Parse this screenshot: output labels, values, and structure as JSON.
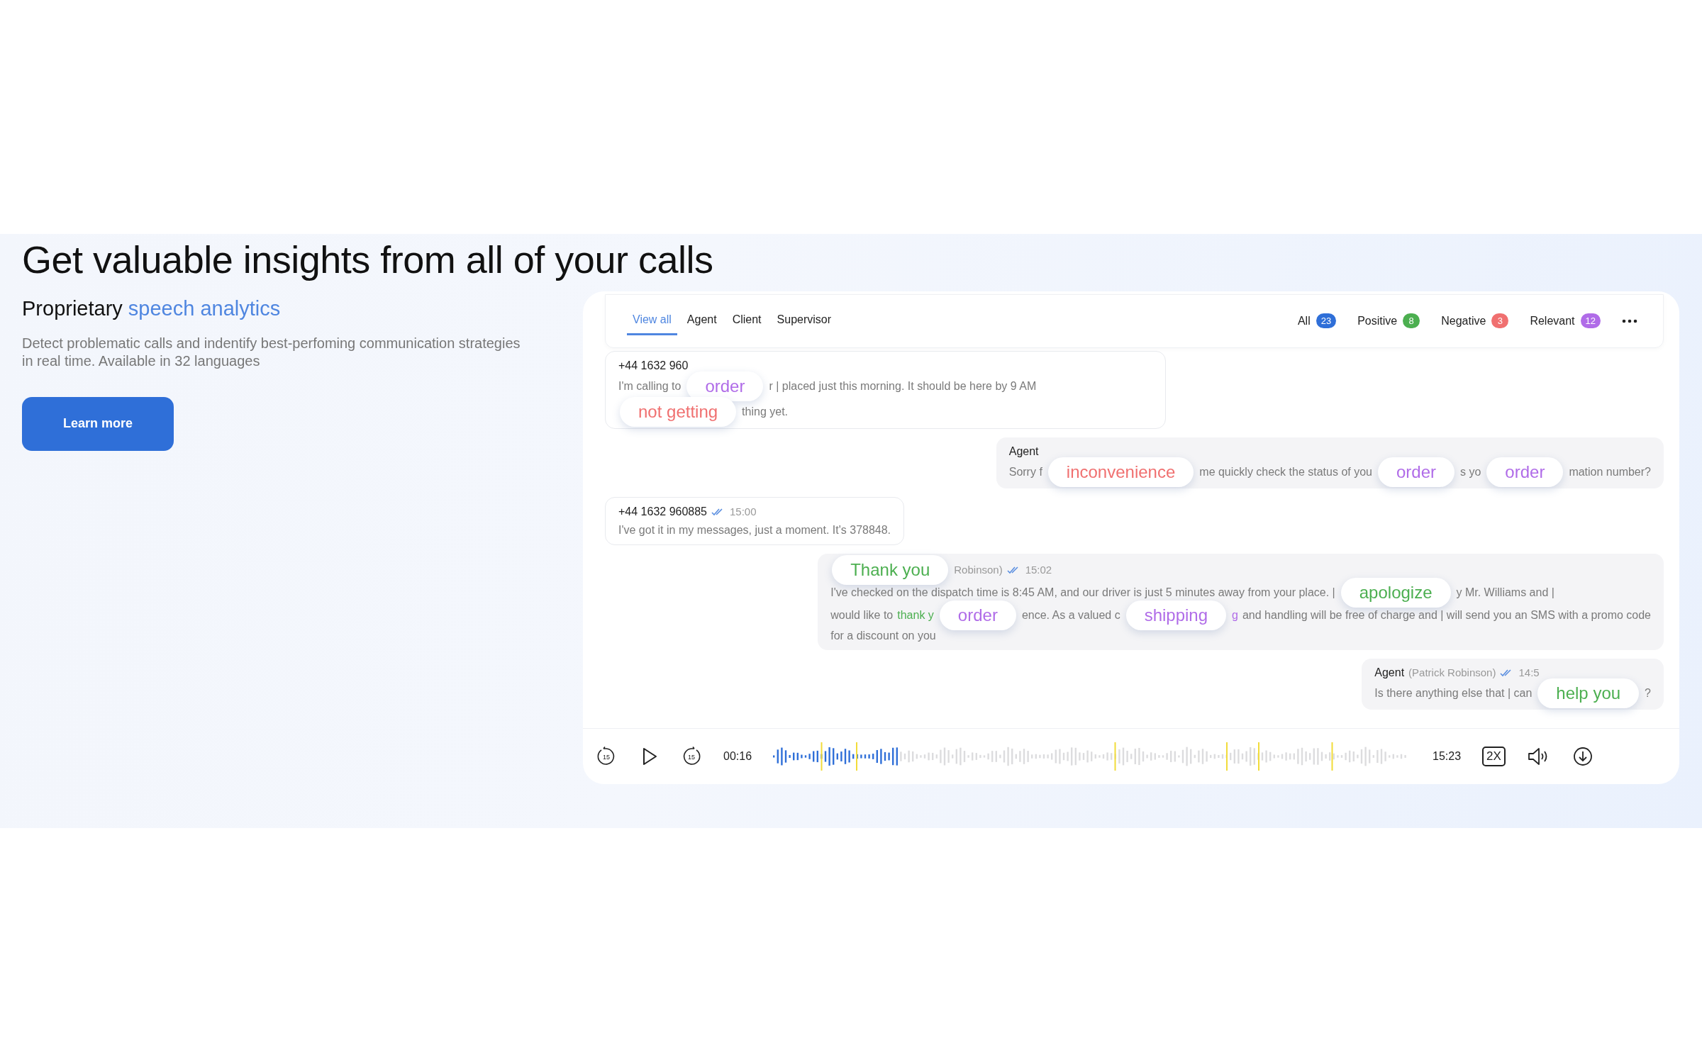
{
  "hero": {
    "title": "Get valuable insights from all of your calls",
    "subtitle": "Proprietary",
    "subtitle_accent": "speech analytics",
    "description": "Detect problematic calls and indentify best-perfoming communication strategies in real time. Available in 32 languages",
    "button": "Learn more"
  },
  "tabs": [
    {
      "label": "View all",
      "selected": true
    },
    {
      "label": "Agent",
      "selected": false
    },
    {
      "label": "Client",
      "selected": false
    },
    {
      "label": "Supervisor",
      "selected": false
    }
  ],
  "filters": [
    {
      "label": "All",
      "count": "23",
      "color": "#2f6fd8"
    },
    {
      "label": "Positive",
      "count": "8",
      "color": "#4caf50"
    },
    {
      "label": "Negative",
      "count": "3",
      "color": "#f07070"
    },
    {
      "label": "Relevant",
      "count": "12",
      "color": "#b06ce8"
    }
  ],
  "messages": [
    {
      "kind": "client",
      "header": [
        {
          "kind": "text",
          "text": "+44 1632 960"
        }
      ],
      "lines": [
        [
          {
            "kind": "muted",
            "text": "I'm calling to"
          },
          {
            "kind": "keyword",
            "text": "order",
            "color": "#b06ce8"
          },
          {
            "kind": "muted",
            "text": "r | placed just this morning. It should be here by 9 AM"
          },
          {
            "kind": "keyword",
            "text": "not getting",
            "color": "#f07070"
          },
          {
            "kind": "muted",
            "text": "thing yet."
          }
        ]
      ]
    },
    {
      "kind": "agent",
      "header": [
        {
          "kind": "text",
          "text": "Agent"
        }
      ],
      "lines": [
        [
          {
            "kind": "muted",
            "text": "Sorry f"
          },
          {
            "kind": "keyword",
            "text": "inconvenience",
            "color": "#f07070"
          },
          {
            "kind": "muted",
            "text": "me quickly check the status of you"
          },
          {
            "kind": "keyword",
            "text": "order",
            "color": "#b06ce8"
          },
          {
            "kind": "muted",
            "text": "s yo"
          },
          {
            "kind": "keyword",
            "text": "order",
            "color": "#b06ce8"
          },
          {
            "kind": "muted",
            "text": "mation number?"
          }
        ]
      ]
    },
    {
      "kind": "client",
      "header": [
        {
          "kind": "text",
          "text": "+44 1632 960885"
        },
        {
          "kind": "check"
        },
        {
          "kind": "muted",
          "text": "15:00"
        }
      ],
      "lines": [
        [
          {
            "kind": "muted",
            "text": "I've got it in my messages, just a moment. It's 378848."
          }
        ]
      ]
    },
    {
      "kind": "agent",
      "header": [
        {
          "kind": "keyword",
          "text": "Thank you",
          "color": "#4caf50"
        },
        {
          "kind": "muted",
          "text": "Robinson)"
        },
        {
          "kind": "check"
        },
        {
          "kind": "muted",
          "text": "15:02"
        }
      ],
      "lines": [
        [
          {
            "kind": "muted",
            "text": "I've checked on the dispatch time is 8:45 AM, and our driver is just 5 minutes away from your place. |"
          },
          {
            "kind": "keyword",
            "text": "apologize",
            "color": "#4caf50"
          },
          {
            "kind": "muted",
            "text": "y Mr. Williams and |"
          }
        ],
        [
          {
            "kind": "muted",
            "text": "would like to"
          },
          {
            "kind": "highlight",
            "text": "thank y",
            "color": "#4caf50"
          },
          {
            "kind": "keyword",
            "text": "order",
            "color": "#b06ce8"
          },
          {
            "kind": "muted",
            "text": "ence. As a valued c"
          },
          {
            "kind": "keyword",
            "text": "shipping",
            "color": "#b06ce8"
          },
          {
            "kind": "highlight",
            "text": "g",
            "color": "#b06ce8"
          },
          {
            "kind": "muted",
            "text": "and handling will be free of charge and | will send you an SMS with a promo code"
          }
        ],
        [
          {
            "kind": "muted",
            "text": "for a discount on you"
          }
        ]
      ]
    },
    {
      "kind": "agent",
      "header": [
        {
          "kind": "text",
          "text": "Agent"
        },
        {
          "kind": "muted",
          "text": "(Patrick Robinson)"
        },
        {
          "kind": "check"
        },
        {
          "kind": "muted",
          "text": "14:5"
        }
      ],
      "lines": [
        [
          {
            "kind": "muted",
            "text": "Is there anything else that | can"
          },
          {
            "kind": "keyword",
            "text": "help you",
            "color": "#4caf50"
          },
          {
            "kind": "muted",
            "text": "?"
          }
        ]
      ]
    }
  ],
  "player": {
    "skip_back": "15",
    "skip_forward": "15",
    "current_time": "00:16",
    "level": 0.2,
    "total_time": "15:23",
    "speed": "2X"
  }
}
